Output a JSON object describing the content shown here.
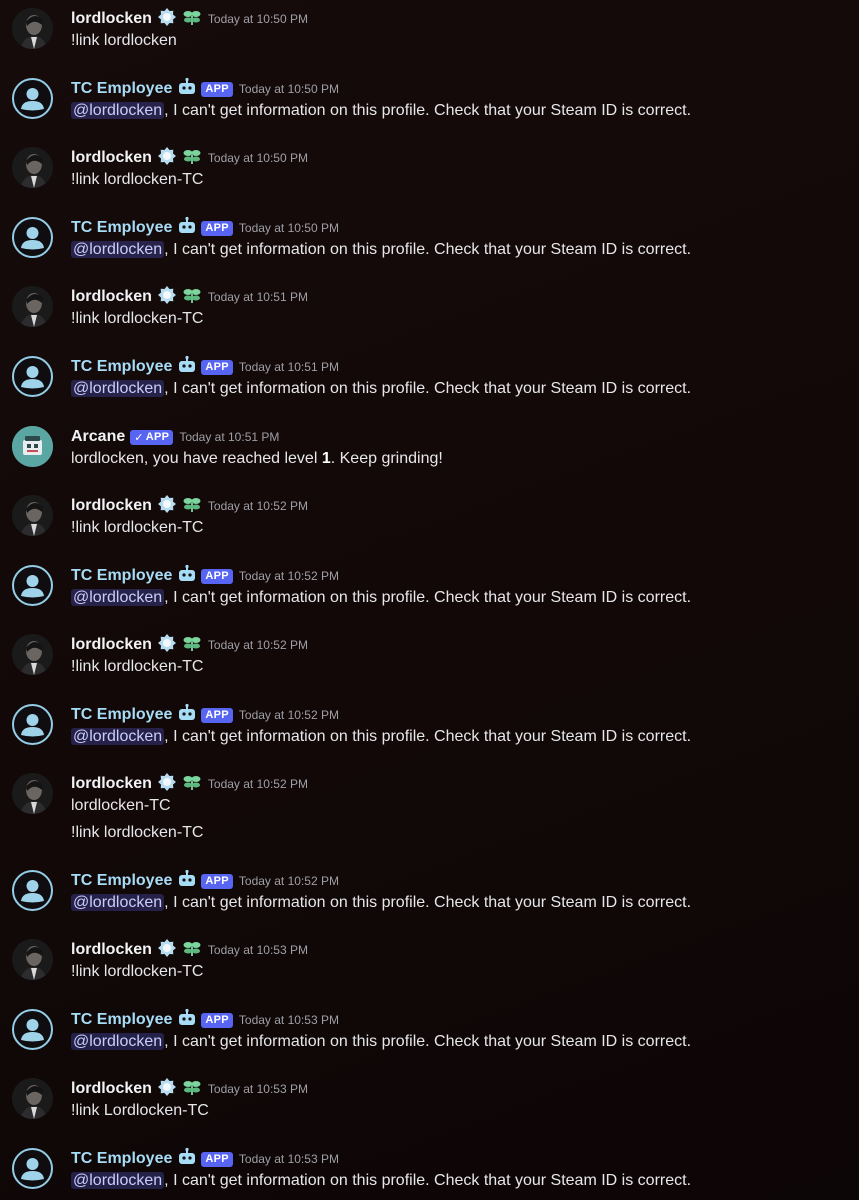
{
  "users": {
    "lordlocken": "lordlocken",
    "tc_employee": "TC Employee",
    "arcane": "Arcane"
  },
  "badges": {
    "app": "APP"
  },
  "mention": "@lordlocken",
  "bot_reply_rest": ", I can't get information on this profile. Check that your Steam ID is correct.",
  "messages": [
    {
      "time": "Today at 10:50 PM",
      "text": "!link lordlocken"
    },
    {
      "time": "Today at 10:50 PM"
    },
    {
      "time": "Today at 10:50 PM",
      "text": "!link lordlocken-TC"
    },
    {
      "time": "Today at 10:50 PM"
    },
    {
      "time": "Today at 10:51 PM",
      "text": "!link lordlocken-TC"
    },
    {
      "time": "Today at 10:51 PM"
    },
    {
      "time": "Today at 10:51 PM",
      "text_pre": "lordlocken, you have reached level ",
      "level": "1",
      "text_post": ". Keep grinding!"
    },
    {
      "time": "Today at 10:52 PM",
      "text": "!link lordlocken-TC"
    },
    {
      "time": "Today at 10:52 PM"
    },
    {
      "time": "Today at 10:52 PM",
      "text": "!link lordlocken-TC"
    },
    {
      "time": "Today at 10:52 PM"
    },
    {
      "time": "Today at 10:52 PM",
      "text": "lordlocken-TC",
      "text2": "!link lordlocken-TC"
    },
    {
      "time": "Today at 10:52 PM"
    },
    {
      "time": "Today at 10:53 PM",
      "text": "!link lordlocken-TC"
    },
    {
      "time": "Today at 10:53 PM"
    },
    {
      "time": "Today at 10:53 PM",
      "text": "!link Lordlocken-TC"
    },
    {
      "time": "Today at 10:53 PM"
    }
  ],
  "icons": {
    "nitro": "nitro-badge-icon",
    "sprout": "sprout-badge-icon",
    "bot": "bot-icon",
    "check": "checkmark-icon",
    "default_avatar": "default-avatar-icon"
  },
  "colors": {
    "accent": "#5865f2",
    "bot_name": "#a6dcf5",
    "mention_bg": "#3a2f5e"
  }
}
